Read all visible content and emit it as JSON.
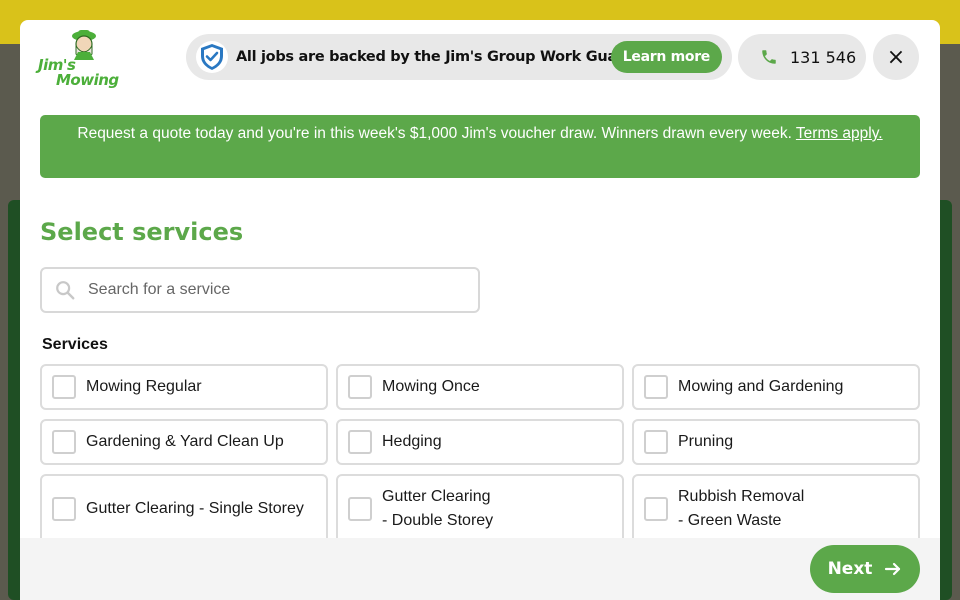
{
  "header": {
    "logo": {
      "line1": "Jim's",
      "line2": "Mowing"
    },
    "guarantee_text": "All jobs are backed by the Jim's Group Work Guarantee",
    "learn_more_label": "Learn more",
    "phone_number": "131 546",
    "close_label": "×"
  },
  "promo": {
    "text": "Request a quote today and you're in this week's $1,000 Jim's voucher draw. Winners drawn every week.",
    "link_text": "Terms apply."
  },
  "title": "Select services",
  "search": {
    "placeholder": "Search for a service",
    "value": ""
  },
  "services_label": "Services",
  "services": [
    {
      "label": "Mowing Regular",
      "checked": false
    },
    {
      "label": "Mowing Once",
      "checked": false
    },
    {
      "label": "Mowing and Gardening",
      "checked": false
    },
    {
      "label": "Gardening & Yard Clean Up",
      "checked": false
    },
    {
      "label": "Hedging",
      "checked": false
    },
    {
      "label": "Pruning",
      "checked": false
    },
    {
      "label": "Gutter Clearing - Single Storey",
      "checked": false
    },
    {
      "label": "Gutter Clearing\n- Double Storey",
      "checked": false
    },
    {
      "label": "Rubbish Removal\n- Green Waste",
      "checked": false
    }
  ],
  "next_label": "Next",
  "colors": {
    "brand_green": "#5ca84a",
    "pill_gray": "#e8e8e8",
    "shield_blue": "#2a78c2"
  },
  "icons": {
    "guarantee": "shield-check-icon",
    "phone": "phone-icon",
    "close": "close-icon",
    "search": "search-icon",
    "next": "arrow-right-icon"
  }
}
